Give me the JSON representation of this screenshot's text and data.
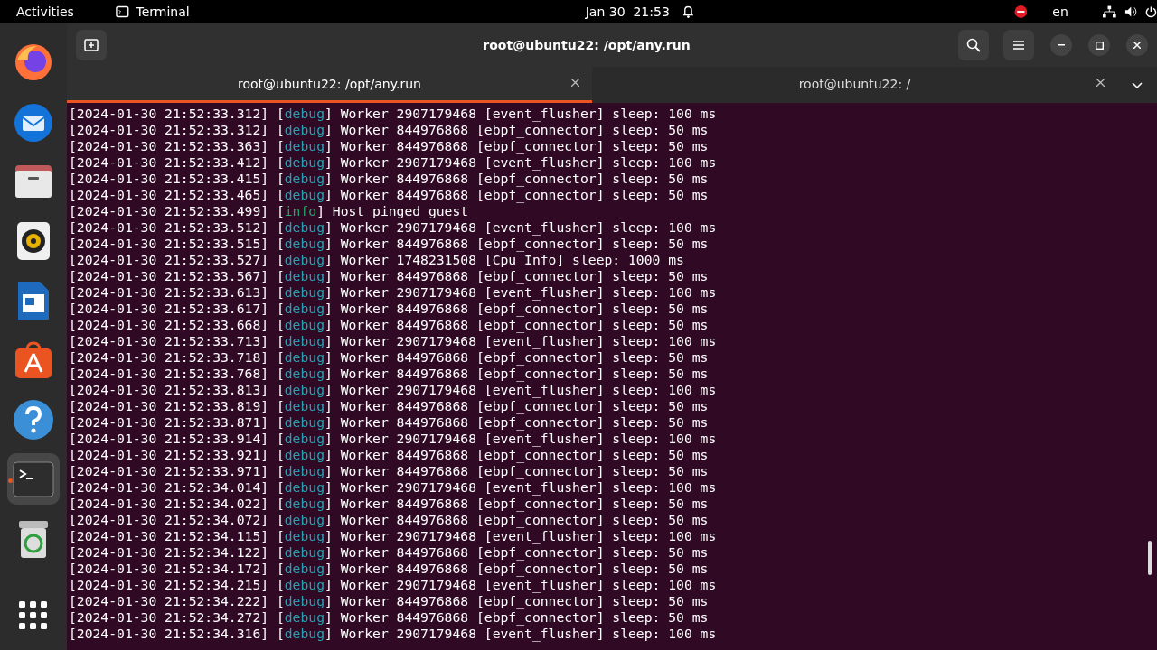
{
  "top_bar": {
    "activities": "Activities",
    "app_name": "Terminal",
    "clock": "Jan 30  21:53",
    "language": "en"
  },
  "dock": {
    "items": [
      {
        "kind": "firefox",
        "active": false
      },
      {
        "kind": "thunderbird",
        "active": false
      },
      {
        "kind": "files",
        "active": false
      },
      {
        "kind": "rhythmbox",
        "active": false
      },
      {
        "kind": "writer",
        "active": false
      },
      {
        "kind": "appcenter",
        "active": false
      },
      {
        "kind": "help",
        "active": false
      },
      {
        "kind": "terminal",
        "active": true
      },
      {
        "kind": "trash",
        "active": false
      }
    ]
  },
  "window": {
    "title": "root@ubuntu22: /opt/any.run"
  },
  "tabs": [
    {
      "label": "root@ubuntu22: /opt/any.run",
      "selected": true
    },
    {
      "label": "root@ubuntu22: /",
      "selected": false
    }
  ],
  "lines": [
    {
      "time": "[2024-01-30 21:52:33.312] [",
      "level": "debug",
      "kind": "debug",
      "message": "] Worker 2907179468 [event_flusher] sleep: 100 ms"
    },
    {
      "time": "[2024-01-30 21:52:33.312] [",
      "level": "debug",
      "kind": "debug",
      "message": "] Worker 844976868 [ebpf_connector] sleep: 50 ms"
    },
    {
      "time": "[2024-01-30 21:52:33.363] [",
      "level": "debug",
      "kind": "debug",
      "message": "] Worker 844976868 [ebpf_connector] sleep: 50 ms"
    },
    {
      "time": "[2024-01-30 21:52:33.412] [",
      "level": "debug",
      "kind": "debug",
      "message": "] Worker 2907179468 [event_flusher] sleep: 100 ms"
    },
    {
      "time": "[2024-01-30 21:52:33.415] [",
      "level": "debug",
      "kind": "debug",
      "message": "] Worker 844976868 [ebpf_connector] sleep: 50 ms"
    },
    {
      "time": "[2024-01-30 21:52:33.465] [",
      "level": "debug",
      "kind": "debug",
      "message": "] Worker 844976868 [ebpf_connector] sleep: 50 ms"
    },
    {
      "time": "[2024-01-30 21:52:33.499] [",
      "level": "info",
      "kind": "info",
      "message": "] Host pinged guest"
    },
    {
      "time": "[2024-01-30 21:52:33.512] [",
      "level": "debug",
      "kind": "debug",
      "message": "] Worker 2907179468 [event_flusher] sleep: 100 ms"
    },
    {
      "time": "[2024-01-30 21:52:33.515] [",
      "level": "debug",
      "kind": "debug",
      "message": "] Worker 844976868 [ebpf_connector] sleep: 50 ms"
    },
    {
      "time": "[2024-01-30 21:52:33.527] [",
      "level": "debug",
      "kind": "debug",
      "message": "] Worker 1748231508 [Cpu Info] sleep: 1000 ms"
    },
    {
      "time": "[2024-01-30 21:52:33.567] [",
      "level": "debug",
      "kind": "debug",
      "message": "] Worker 844976868 [ebpf_connector] sleep: 50 ms"
    },
    {
      "time": "[2024-01-30 21:52:33.613] [",
      "level": "debug",
      "kind": "debug",
      "message": "] Worker 2907179468 [event_flusher] sleep: 100 ms"
    },
    {
      "time": "[2024-01-30 21:52:33.617] [",
      "level": "debug",
      "kind": "debug",
      "message": "] Worker 844976868 [ebpf_connector] sleep: 50 ms"
    },
    {
      "time": "[2024-01-30 21:52:33.668] [",
      "level": "debug",
      "kind": "debug",
      "message": "] Worker 844976868 [ebpf_connector] sleep: 50 ms"
    },
    {
      "time": "[2024-01-30 21:52:33.713] [",
      "level": "debug",
      "kind": "debug",
      "message": "] Worker 2907179468 [event_flusher] sleep: 100 ms"
    },
    {
      "time": "[2024-01-30 21:52:33.718] [",
      "level": "debug",
      "kind": "debug",
      "message": "] Worker 844976868 [ebpf_connector] sleep: 50 ms"
    },
    {
      "time": "[2024-01-30 21:52:33.768] [",
      "level": "debug",
      "kind": "debug",
      "message": "] Worker 844976868 [ebpf_connector] sleep: 50 ms"
    },
    {
      "time": "[2024-01-30 21:52:33.813] [",
      "level": "debug",
      "kind": "debug",
      "message": "] Worker 2907179468 [event_flusher] sleep: 100 ms"
    },
    {
      "time": "[2024-01-30 21:52:33.819] [",
      "level": "debug",
      "kind": "debug",
      "message": "] Worker 844976868 [ebpf_connector] sleep: 50 ms"
    },
    {
      "time": "[2024-01-30 21:52:33.871] [",
      "level": "debug",
      "kind": "debug",
      "message": "] Worker 844976868 [ebpf_connector] sleep: 50 ms"
    },
    {
      "time": "[2024-01-30 21:52:33.914] [",
      "level": "debug",
      "kind": "debug",
      "message": "] Worker 2907179468 [event_flusher] sleep: 100 ms"
    },
    {
      "time": "[2024-01-30 21:52:33.921] [",
      "level": "debug",
      "kind": "debug",
      "message": "] Worker 844976868 [ebpf_connector] sleep: 50 ms"
    },
    {
      "time": "[2024-01-30 21:52:33.971] [",
      "level": "debug",
      "kind": "debug",
      "message": "] Worker 844976868 [ebpf_connector] sleep: 50 ms"
    },
    {
      "time": "[2024-01-30 21:52:34.014] [",
      "level": "debug",
      "kind": "debug",
      "message": "] Worker 2907179468 [event_flusher] sleep: 100 ms"
    },
    {
      "time": "[2024-01-30 21:52:34.022] [",
      "level": "debug",
      "kind": "debug",
      "message": "] Worker 844976868 [ebpf_connector] sleep: 50 ms"
    },
    {
      "time": "[2024-01-30 21:52:34.072] [",
      "level": "debug",
      "kind": "debug",
      "message": "] Worker 844976868 [ebpf_connector] sleep: 50 ms"
    },
    {
      "time": "[2024-01-30 21:52:34.115] [",
      "level": "debug",
      "kind": "debug",
      "message": "] Worker 2907179468 [event_flusher] sleep: 100 ms"
    },
    {
      "time": "[2024-01-30 21:52:34.122] [",
      "level": "debug",
      "kind": "debug",
      "message": "] Worker 844976868 [ebpf_connector] sleep: 50 ms"
    },
    {
      "time": "[2024-01-30 21:52:34.172] [",
      "level": "debug",
      "kind": "debug",
      "message": "] Worker 844976868 [ebpf_connector] sleep: 50 ms"
    },
    {
      "time": "[2024-01-30 21:52:34.215] [",
      "level": "debug",
      "kind": "debug",
      "message": "] Worker 2907179468 [event_flusher] sleep: 100 ms"
    },
    {
      "time": "[2024-01-30 21:52:34.222] [",
      "level": "debug",
      "kind": "debug",
      "message": "] Worker 844976868 [ebpf_connector] sleep: 50 ms"
    },
    {
      "time": "[2024-01-30 21:52:34.272] [",
      "level": "debug",
      "kind": "debug",
      "message": "] Worker 844976868 [ebpf_connector] sleep: 50 ms"
    },
    {
      "time": "[2024-01-30 21:52:34.316] [",
      "level": "debug",
      "kind": "debug",
      "message": "] Worker 2907179468 [event_flusher] sleep: 100 ms"
    }
  ]
}
